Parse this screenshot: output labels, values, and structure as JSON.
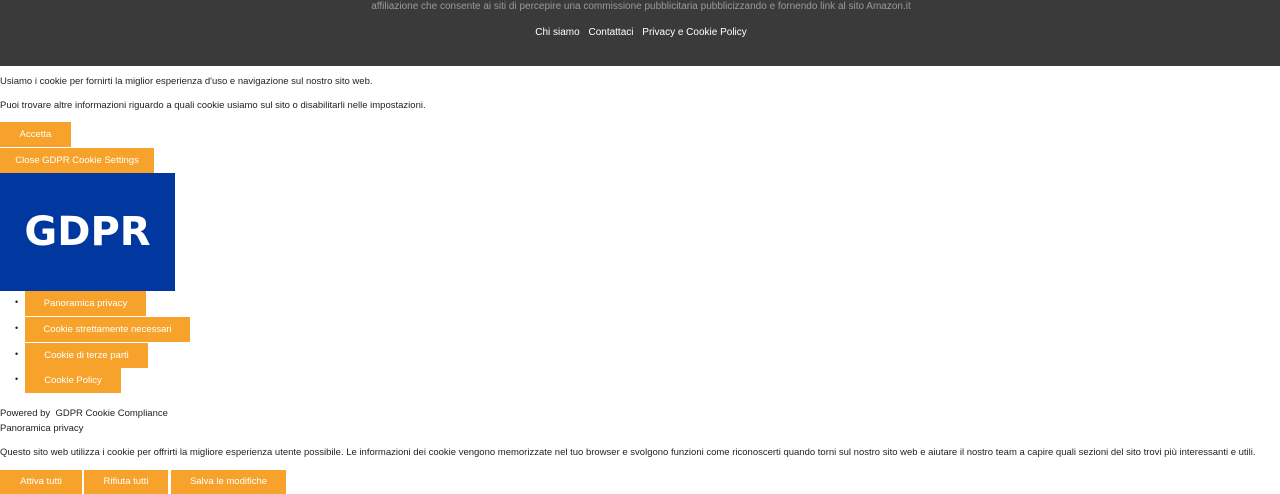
{
  "footer": {
    "affiliate_text": "affiliazione che consente ai siti di percepire una commissione pubblicitaria pubblicizzando e fornendo link al sito Amazon.it",
    "nav": [
      "Chi siamo",
      "Contattaci",
      "Privacy e Cookie Policy"
    ]
  },
  "cookie_banner": {
    "intro": "Usiamo i cookie per fornirti la miglior esperienza d'uso e navigazione sul nostro sito web.",
    "more_info": "Puoi trovare altre informazioni riguardo a quali cookie usiamo sul sito o disabilitarli nelle impostazioni.",
    "accept_label": "Accetta",
    "close_settings_label": "Close GDPR Cookie Settings"
  },
  "settings": {
    "logo_text": "GDPR",
    "tabs": [
      "Panoramica privacy",
      "Cookie strettamente necessari",
      "Cookie di terze parti",
      "Cookie Policy"
    ],
    "powered_by": "Powered by  GDPR Cookie Compliance",
    "section_title": "Panoramica privacy",
    "section_text": "Questo sito web utilizza i cookie per offrirti la migliore esperienza utente possibile. Le informazioni dei cookie vengono memorizzate nel tuo browser e svolgono funzioni come riconoscerti quando torni sul nostro sito web e aiutare il nostro team a capire quali sezioni del sito trovi più interessanti e utili.",
    "actions": {
      "enable_all": "Attiva tutti",
      "reject_all": "Rifiuta tutti",
      "save": "Salva le modifiche"
    }
  },
  "colors": {
    "footer_bg": "#3a3a3a",
    "accent": "#f7a22a",
    "logo_bg": "#0038a0"
  }
}
